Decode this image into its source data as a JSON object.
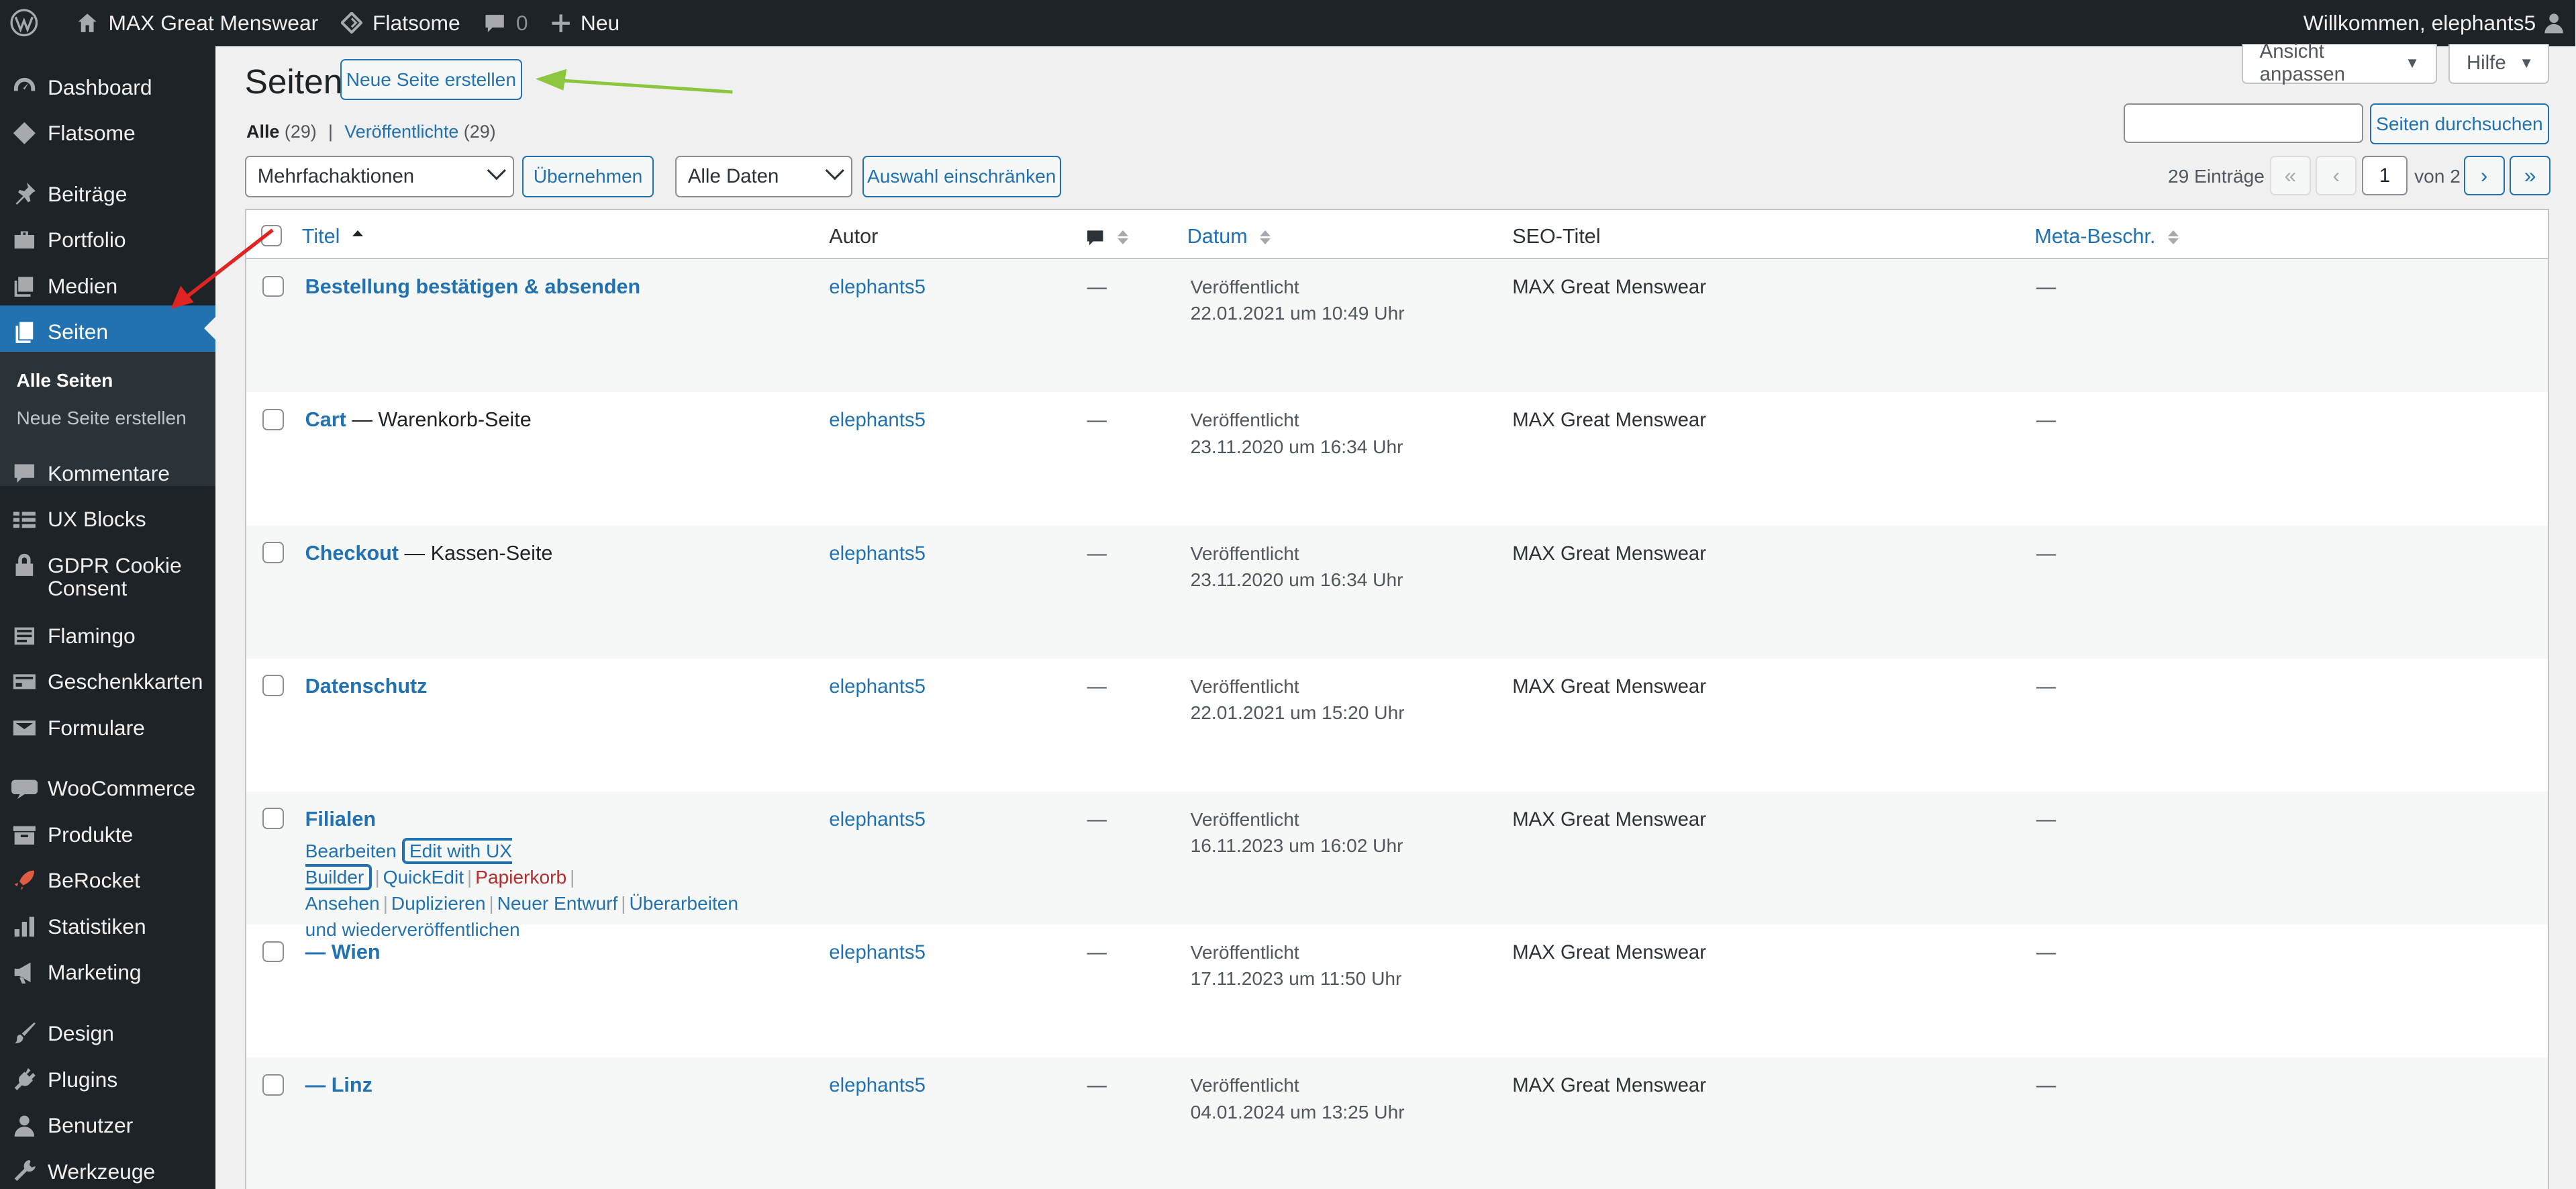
{
  "admin_bar": {
    "site_name": "MAX Great Menswear",
    "theme": "Flatsome",
    "comments_count": "0",
    "new_label": "Neu",
    "welcome": "Willkommen, elephants5"
  },
  "sidebar": {
    "items": [
      {
        "label": "Dashboard",
        "icon": "dashboard-icon"
      },
      {
        "label": "Flatsome",
        "icon": "flatsome-icon"
      },
      {
        "label": "Beiträge",
        "icon": "pin-icon"
      },
      {
        "label": "Portfolio",
        "icon": "portfolio-icon"
      },
      {
        "label": "Medien",
        "icon": "media-icon"
      },
      {
        "label": "Seiten",
        "icon": "pages-icon"
      },
      {
        "label": "Kommentare",
        "icon": "comments-icon"
      },
      {
        "label": "UX Blocks",
        "icon": "ux-blocks-icon"
      },
      {
        "label": "GDPR Cookie Consent",
        "icon": "lock-icon"
      },
      {
        "label": "Flamingo",
        "icon": "flamingo-icon"
      },
      {
        "label": "Geschenkkarten",
        "icon": "gift-card-icon"
      },
      {
        "label": "Formulare",
        "icon": "mail-icon"
      },
      {
        "label": "WooCommerce",
        "icon": "woocommerce-icon"
      },
      {
        "label": "Produkte",
        "icon": "archive-icon"
      },
      {
        "label": "BeRocket",
        "icon": "rocket-icon"
      },
      {
        "label": "Statistiken",
        "icon": "chart-icon"
      },
      {
        "label": "Marketing",
        "icon": "megaphone-icon"
      },
      {
        "label": "Design",
        "icon": "brush-icon"
      },
      {
        "label": "Plugins",
        "icon": "plug-icon"
      },
      {
        "label": "Benutzer",
        "icon": "user-icon"
      },
      {
        "label": "Werkzeuge",
        "icon": "wrench-icon"
      }
    ],
    "submenu": {
      "all_pages": "Alle Seiten",
      "new_page": "Neue Seite erstellen"
    }
  },
  "header": {
    "title": "Seiten",
    "add_new": "Neue Seite erstellen",
    "screen_options": "Ansicht anpassen",
    "help": "Hilfe"
  },
  "filters": {
    "all_label": "Alle",
    "all_count": "(29)",
    "published_label": "Veröffentlichte",
    "published_count": "(29)",
    "separator": "|",
    "bulk_actions": "Mehrfachaktionen",
    "apply": "Übernehmen",
    "all_dates": "Alle Daten",
    "filter": "Auswahl einschränken",
    "search_button": "Seiten durchsuchen"
  },
  "pagination": {
    "entries": "29 Einträge",
    "first": "«",
    "prev": "‹",
    "current": "1",
    "of": "von 2",
    "next": "›",
    "last": "»"
  },
  "table": {
    "columns": {
      "title": "Titel",
      "author": "Autor",
      "date": "Datum",
      "seo_title": "SEO-Titel",
      "meta_desc": "Meta-Beschr."
    },
    "rows": [
      {
        "title": "Bestellung bestätigen & absenden",
        "suffix": "",
        "author": "elephants5",
        "comments": "—",
        "status": "Veröffentlicht",
        "date": "22.01.2021 um 10:49 Uhr",
        "seo": "MAX Great Menswear",
        "meta": "—"
      },
      {
        "title": "Cart",
        "suffix": " — Warenkorb-Seite",
        "author": "elephants5",
        "comments": "—",
        "status": "Veröffentlicht",
        "date": "23.11.2020 um 16:34 Uhr",
        "seo": "MAX Great Menswear",
        "meta": "—"
      },
      {
        "title": "Checkout",
        "suffix": " — Kassen-Seite",
        "author": "elephants5",
        "comments": "—",
        "status": "Veröffentlicht",
        "date": "23.11.2020 um 16:34 Uhr",
        "seo": "MAX Great Menswear",
        "meta": "—"
      },
      {
        "title": "Datenschutz",
        "suffix": "",
        "author": "elephants5",
        "comments": "—",
        "status": "Veröffentlicht",
        "date": "22.01.2021 um 15:20 Uhr",
        "seo": "MAX Great Menswear",
        "meta": "—"
      },
      {
        "title": "Filialen",
        "suffix": "",
        "author": "elephants5",
        "comments": "—",
        "status": "Veröffentlicht",
        "date": "16.11.2023 um 16:02 Uhr",
        "seo": "MAX Great Menswear",
        "meta": "—"
      },
      {
        "title": "— Wien",
        "suffix": "",
        "author": "elephants5",
        "comments": "—",
        "status": "Veröffentlicht",
        "date": "17.11.2023 um 11:50 Uhr",
        "seo": "MAX Great Menswear",
        "meta": "—"
      },
      {
        "title": "— Linz",
        "suffix": "",
        "author": "elephants5",
        "comments": "—",
        "status": "Veröffentlicht",
        "date": "04.01.2024 um 13:25 Uhr",
        "seo": "MAX Great Menswear",
        "meta": "—"
      }
    ],
    "row_actions": {
      "edit": "Bearbeiten",
      "ux_builder": "Edit with UX Builder",
      "quick_edit": "QuickEdit",
      "trash": "Papierkorb",
      "view": "Ansehen",
      "duplicate": "Duplizieren",
      "new_draft": "Neuer Entwurf",
      "rewrite": "Überarbeiten und wiederveröffentlichen"
    }
  },
  "colors": {
    "admin_dark": "#1d2327",
    "accent": "#2271b1",
    "annotation_green": "#8cc63f",
    "annotation_red": "#e02424",
    "trash_red": "#b32d2e"
  }
}
